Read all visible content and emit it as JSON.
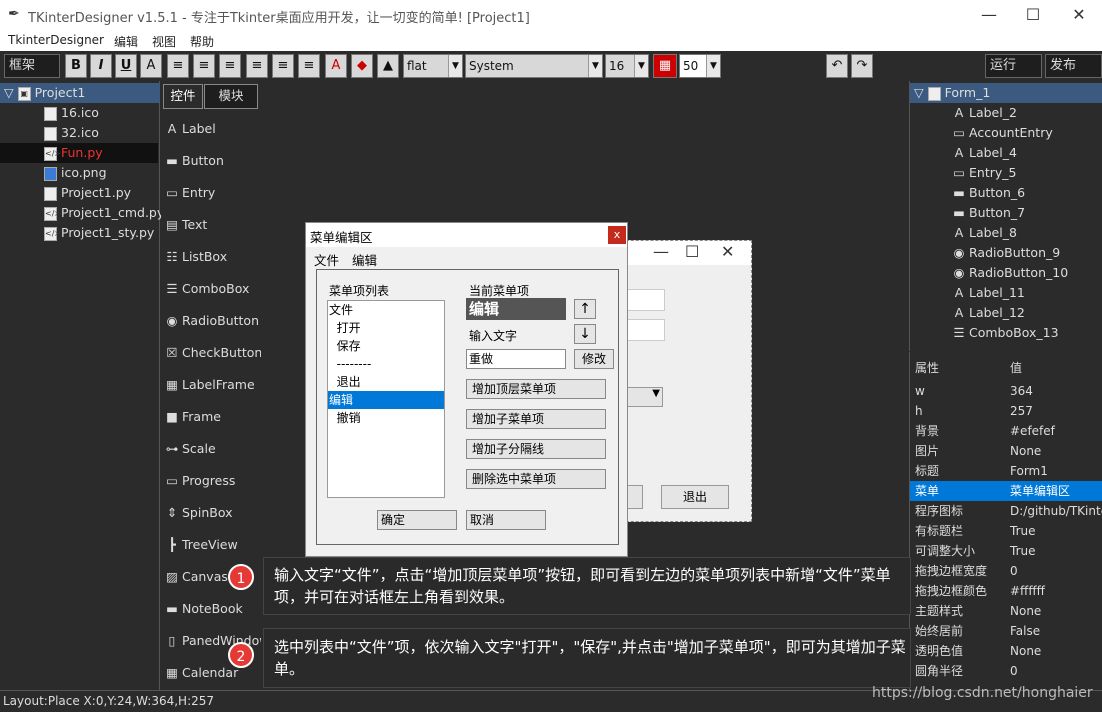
{
  "window": {
    "title": "TKinterDesigner v1.5.1 - 专注于Tkinter桌面应用开发，让一切变的简单!    [Project1]",
    "min": "—",
    "max": "☐",
    "close": "✕"
  },
  "menubar": [
    "TkinterDesigner",
    "编辑",
    "视图",
    "帮助"
  ],
  "toolbar": {
    "frame_label": "框架",
    "bold": "B",
    "italic": "I",
    "underline": "U",
    "relief": "flat",
    "font": "System",
    "font_size": "16",
    "grid_size": "50",
    "run": "运行",
    "publish": "发布"
  },
  "project": {
    "root": "Project1",
    "files": [
      "16.ico",
      "32.ico",
      "Fun.py",
      "ico.png",
      "Project1.py",
      "Project1_cmd.py",
      "Project1_sty.py"
    ],
    "selected": "Fun.py"
  },
  "tabs": [
    "控件",
    "模块"
  ],
  "controls": [
    "Label",
    "Button",
    "Entry",
    "Text",
    "ListBox",
    "ComboBox",
    "RadioButton",
    "CheckButton",
    "LabelFrame",
    "Frame",
    "Scale",
    "Progress",
    "SpinBox",
    "TreeView",
    "Canvas",
    "NoteBook",
    "PanedWindow",
    "Calendar"
  ],
  "form_preview": {
    "exit_button": "退出"
  },
  "dialog": {
    "title": "菜单编辑区",
    "close": "x",
    "menu": [
      "文件",
      "编辑"
    ],
    "list_title": "菜单项列表",
    "list_items": [
      "文件",
      "  打开",
      "  保存",
      "  --------",
      "  退出",
      "编辑",
      "  撤销"
    ],
    "selected_index": 5,
    "current_label": "当前菜单项",
    "current_value": "编辑",
    "up": "↑",
    "down": "↓",
    "input_label": "输入文字",
    "input_value": "重做",
    "modify": "修改",
    "add_top": "增加顶层菜单项",
    "add_sub": "增加子菜单项",
    "add_sep": "增加子分隔线",
    "delete": "删除选中菜单项",
    "ok": "确定",
    "cancel": "取消"
  },
  "objtree": {
    "root": "Form_1",
    "items": [
      "Label_2",
      "AccountEntry",
      "Label_4",
      "Entry_5",
      "Button_6",
      "Button_7",
      "Label_8",
      "RadioButton_9",
      "RadioButton_10",
      "Label_11",
      "Label_12",
      "ComboBox_13"
    ]
  },
  "props": {
    "header_key": "属性",
    "header_val": "值",
    "rows": [
      [
        "w",
        "364"
      ],
      [
        "h",
        "257"
      ],
      [
        "背景",
        "#efefef"
      ],
      [
        "图片",
        "None"
      ],
      [
        "标题",
        "Form1"
      ],
      [
        "菜单",
        "菜单编辑区"
      ],
      [
        "程序图标",
        "D:/github/TKinter"
      ],
      [
        "有标题栏",
        "True"
      ],
      [
        "可调整大小",
        "True"
      ],
      [
        "拖拽边框宽度",
        "0"
      ],
      [
        "拖拽边框颜色",
        "#ffffff"
      ],
      [
        "主题样式",
        "None"
      ],
      [
        "始终居前",
        "False"
      ],
      [
        "透明色值",
        "None"
      ],
      [
        "圆角半径",
        "0"
      ]
    ],
    "selected_index": 5
  },
  "callouts": [
    {
      "num": "1",
      "text": "输入文字“文件”，点击“增加顶层菜单项”按钮，即可看到左边的菜单项列表中新增“文件”菜单项，并可在对话框左上角看到效果。"
    },
    {
      "num": "2",
      "text": "选中列表中“文件”项，依次输入文字\"打开\"，\"保存\",并点击\"增加子菜单项\"，即可为其增加子菜单。"
    }
  ],
  "status": "Layout:Place  X:0,Y:24,W:364,H:257",
  "watermark": "https://blog.csdn.net/honghaier"
}
